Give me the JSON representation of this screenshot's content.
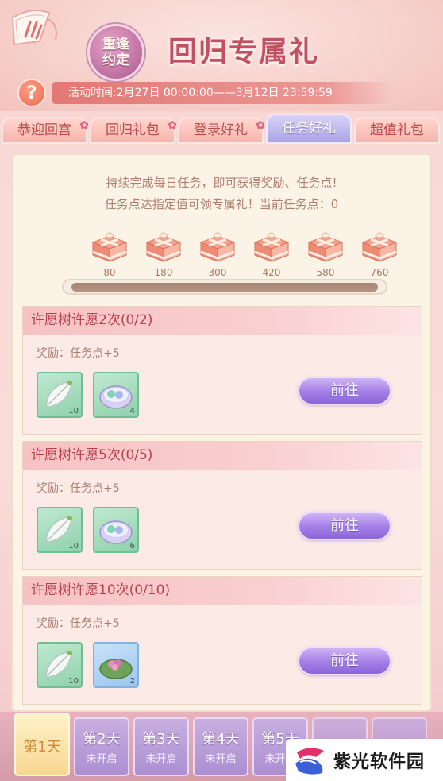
{
  "header": {
    "seal_text": "重逢约定",
    "title": "回归专属礼",
    "help_label": "?",
    "activity_time": "活动时间:2月27日 00:00:00——3月12日 23:59:59"
  },
  "tabs": [
    {
      "label": "恭迎回宫",
      "badge": true,
      "active": false
    },
    {
      "label": "回归礼包",
      "badge": true,
      "active": false
    },
    {
      "label": "登录好礼",
      "badge": true,
      "active": false
    },
    {
      "label": "任务好礼",
      "badge": false,
      "active": true
    },
    {
      "label": "超值礼包",
      "badge": false,
      "active": false
    }
  ],
  "intro": {
    "line1": "持续完成每日任务，即可获得奖励、任务点!",
    "line2": "任务点达指定值可领专属礼！当前任务点：0"
  },
  "milestones": [
    "80",
    "180",
    "300",
    "420",
    "580",
    "760"
  ],
  "progress_fraction": 0,
  "tasks": [
    {
      "title": "许愿树许愿2次(0/2)",
      "reward": "奖励：任务点+5",
      "items": [
        {
          "icon": "feather-leaf-icon",
          "count": "10",
          "frame": "green"
        },
        {
          "icon": "powder-compact-icon",
          "count": "4",
          "frame": "green"
        }
      ],
      "button": "前往"
    },
    {
      "title": "许愿树许愿5次(0/5)",
      "reward": "奖励：任务点+5",
      "items": [
        {
          "icon": "feather-leaf-icon",
          "count": "10",
          "frame": "green"
        },
        {
          "icon": "powder-compact-icon",
          "count": "6",
          "frame": "green"
        }
      ],
      "button": "前往"
    },
    {
      "title": "许愿树许愿10次(0/10)",
      "reward": "奖励：任务点+5",
      "items": [
        {
          "icon": "feather-leaf-icon",
          "count": "10",
          "frame": "green"
        },
        {
          "icon": "lotus-leaf-icon",
          "count": "2",
          "frame": "blue"
        }
      ],
      "button": "前往"
    }
  ],
  "days": [
    {
      "label": "第1天",
      "sub": "",
      "active": true
    },
    {
      "label": "第2天",
      "sub": "未开启",
      "active": false
    },
    {
      "label": "第3天",
      "sub": "未开启",
      "active": false
    },
    {
      "label": "第4天",
      "sub": "未开启",
      "active": false
    },
    {
      "label": "第5天",
      "sub": "未开启",
      "active": false
    }
  ],
  "watermark": "紫光软件园",
  "colors": {
    "accent_tab_active": "#aaa3e6",
    "tab_inactive": "#f6b5ad",
    "go_button": "#a27ee6",
    "task_title": "#b5414d"
  }
}
